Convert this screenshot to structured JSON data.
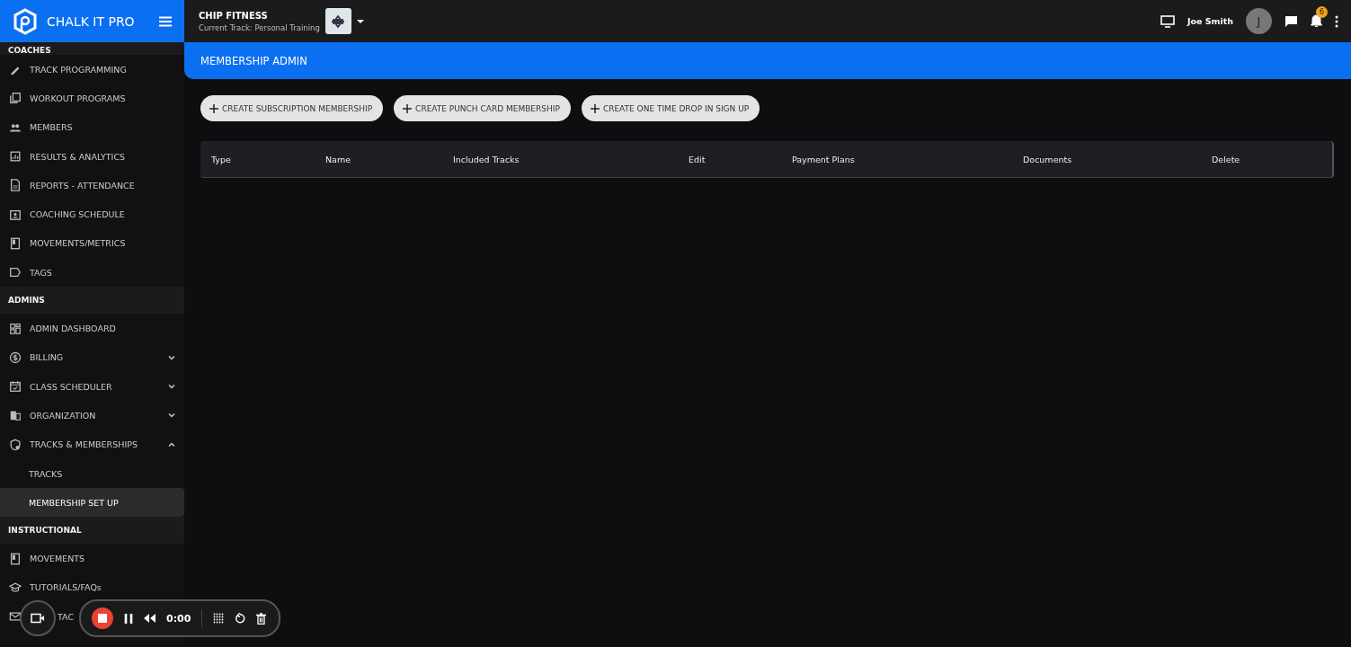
{
  "brand": {
    "name": "CHALK IT PRO"
  },
  "gym": {
    "name": "CHIP FITNESS",
    "track": "Current Track: Personal Training"
  },
  "user": {
    "name": "Joe Smith",
    "initial": "J",
    "notifications": "6"
  },
  "sidebar": {
    "sections": [
      {
        "title": "COACHES",
        "items": [
          {
            "label": "TRACK PROGRAMMING",
            "selected": false
          },
          {
            "label": "WORKOUT PROGRAMS",
            "selected": false
          },
          {
            "label": "MEMBERS",
            "selected": false
          },
          {
            "label": "RESULTS & ANALYTICS",
            "selected": false
          },
          {
            "label": "REPORTS - ATTENDANCE",
            "selected": false
          },
          {
            "label": "COACHING SCHEDULE",
            "selected": false
          },
          {
            "label": "MOVEMENTS/METRICS",
            "selected": false
          },
          {
            "label": "TAGS",
            "selected": false
          }
        ]
      },
      {
        "title": "ADMINS",
        "items": [
          {
            "label": "ADMIN DASHBOARD",
            "selected": false
          },
          {
            "label": "BILLING",
            "selected": false,
            "expanded": false
          },
          {
            "label": "CLASS SCHEDULER",
            "selected": false,
            "expanded": false
          },
          {
            "label": "ORGANIZATION",
            "selected": false,
            "expanded": false
          },
          {
            "label": "TRACKS & MEMBERSHIPS",
            "selected": false,
            "expanded": true,
            "children": [
              {
                "label": "TRACKS",
                "selected": false
              },
              {
                "label": "MEMBERSHIP SET UP",
                "selected": true
              }
            ]
          }
        ]
      },
      {
        "title": "INSTRUCTIONAL",
        "items": [
          {
            "label": "MOVEMENTS",
            "selected": false
          },
          {
            "label": "TUTORIALS/FAQs",
            "selected": false
          },
          {
            "label": "TAC"
          }
        ]
      }
    ]
  },
  "page": {
    "title": "MEMBERSHIP ADMIN"
  },
  "actions": [
    "CREATE SUBSCRIPTION MEMBERSHIP",
    "CREATE PUNCH CARD MEMBERSHIP",
    "CREATE ONE TIME DROP IN SIGN UP"
  ],
  "table": {
    "columns": [
      "Type",
      "Name",
      "Included Tracks",
      "Edit",
      "Payment Plans",
      "Documents",
      "Delete"
    ]
  },
  "recorder": {
    "time": "0:00"
  }
}
